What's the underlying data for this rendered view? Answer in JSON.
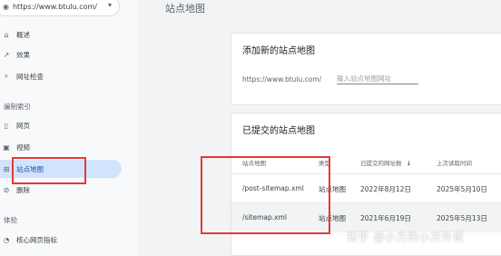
{
  "property": {
    "url": "https://www.btulu.com/"
  },
  "header": {
    "title": "站点地图"
  },
  "sidebar": {
    "items_top": [
      {
        "icon": "⌂",
        "label": "概述"
      },
      {
        "icon": "↗",
        "label": "效果"
      },
      {
        "icon": "⌕",
        "label": "网址检查"
      }
    ],
    "section_index": "编制索引",
    "items_index": [
      {
        "icon": "▯",
        "label": "网页"
      },
      {
        "icon": "▣",
        "label": "视频"
      },
      {
        "icon": "⊞",
        "label": "站点地图"
      },
      {
        "icon": "⊘",
        "label": "删除"
      }
    ],
    "section_experience": "体验",
    "items_experience": [
      {
        "icon": "◔",
        "label": "核心网页指标"
      }
    ]
  },
  "add_sitemap": {
    "title": "添加新的站点地图",
    "url_prefix": "https://www.btulu.com/",
    "placeholder": "输入站点地图网址"
  },
  "submitted": {
    "title": "已提交的站点地图",
    "columns": [
      "站点地图",
      "类型",
      "已提交的网址数",
      "上次读取时间"
    ],
    "sort_icon": "↓",
    "rows": [
      {
        "sitemap": "/post-sitemap.xml",
        "type": "站点地图",
        "submitted": "2022年8月12日",
        "last_read": "2025年5月10日"
      },
      {
        "sitemap": "/sitemap.xml",
        "type": "站点地图",
        "submitted": "2021年6月19日",
        "last_read": "2025年5月13日"
      }
    ]
  },
  "watermark": "知乎 @小方的小方外贸",
  "colors": {
    "highlight": "#e53935",
    "active_nav": "#d2e3fc"
  }
}
